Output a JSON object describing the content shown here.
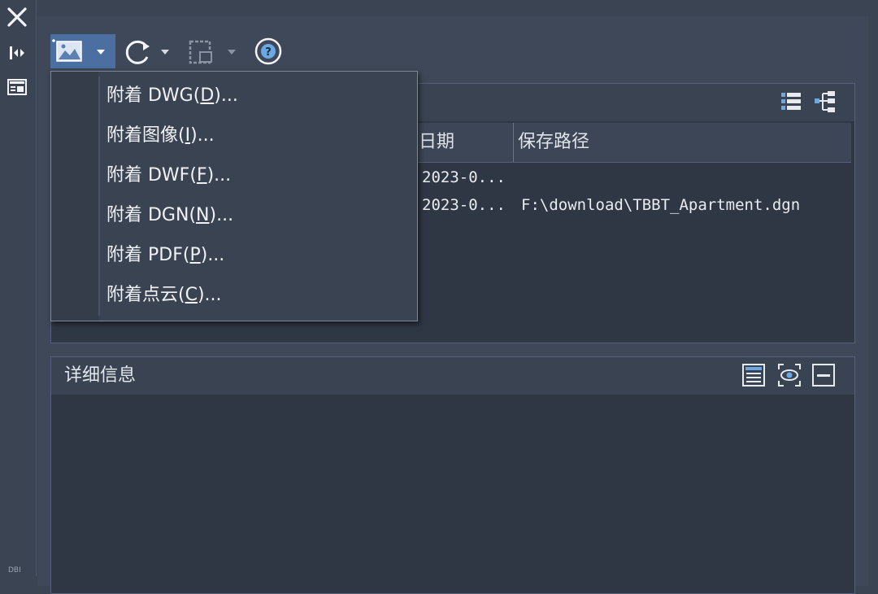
{
  "toolbar": {
    "icons": [
      "attach-image-icon",
      "dropdown-arrow-icon",
      "refresh-icon",
      "change-path-icon",
      "help-icon"
    ]
  },
  "references": {
    "columns": [
      "日期",
      "保存路径"
    ],
    "rows": [
      {
        "date": "2023-0...",
        "path": ""
      },
      {
        "date": "2023-0...",
        "path": "F:\\download\\TBBT_Apartment.dgn"
      }
    ]
  },
  "attach_menu": {
    "items": [
      {
        "label": "附着 DWG(",
        "key": "D",
        "suffix": ")..."
      },
      {
        "label": "附着图像(",
        "key": "I",
        "suffix": ")..."
      },
      {
        "label": "附着 DWF(",
        "key": "F",
        "suffix": ")..."
      },
      {
        "label": "附着 DGN(",
        "key": "N",
        "suffix": ")..."
      },
      {
        "label": "附着 PDF(",
        "key": "P",
        "suffix": ")..."
      },
      {
        "label": "附着点云(",
        "key": "C",
        "suffix": ")..."
      }
    ]
  },
  "details": {
    "title": "详细信息"
  },
  "sidebar": {
    "footer": "DBI"
  },
  "colors": {
    "background": "#3b4453",
    "panel": "#2f3744",
    "accent": "#4a6fa0"
  }
}
